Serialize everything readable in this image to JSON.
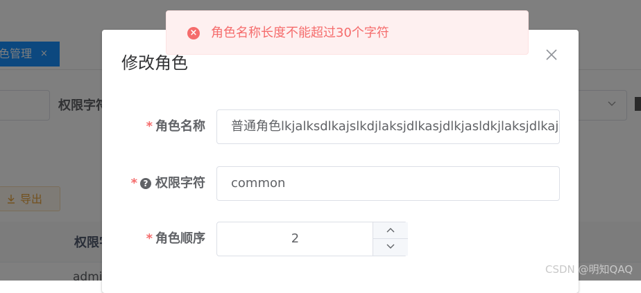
{
  "background": {
    "tab": {
      "label": "色管理",
      "close": "×"
    },
    "filter_label": "权限字符",
    "select_chevron": "⌄",
    "export_button": {
      "icon": "download-icon",
      "label": "导出"
    },
    "table_header_label": "权限字",
    "row_text": "admin"
  },
  "dialog": {
    "title": "修改角色",
    "close_icon": "×",
    "fields": {
      "role_name": {
        "required": "*",
        "label": "角色名称",
        "value": "普通角色lkjalksdlkajslkdjlaksjdlkasjdlkjasldkjlaksjdlkaj"
      },
      "permission": {
        "required": "*",
        "help_icon": "?",
        "label": "权限字符",
        "value": "common"
      },
      "order": {
        "required": "*",
        "label": "角色顺序",
        "value": "2"
      }
    }
  },
  "toast": {
    "type": "error",
    "icon": "×",
    "message": "角色名称长度不能超过30个字符"
  },
  "watermark": "CSDN @明知QAQ",
  "colors": {
    "primary": "#1890ff",
    "danger": "#f56c6c",
    "warning": "#e6a23c"
  }
}
